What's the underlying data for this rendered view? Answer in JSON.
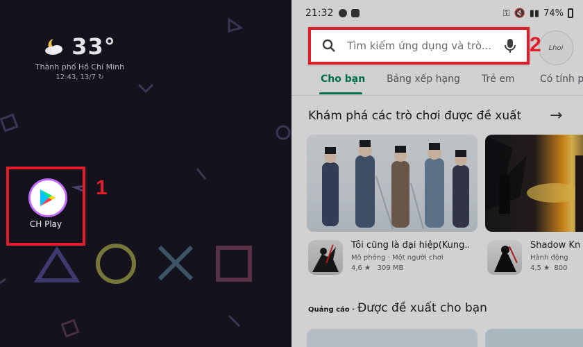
{
  "home": {
    "weather": {
      "temperature": "33°",
      "city": "Thành phố Hồ Chí Minh",
      "datetime": "12:43, 13/7"
    },
    "app": {
      "label": "CH Play"
    },
    "step": "1"
  },
  "store": {
    "status": {
      "time": "21:32",
      "battery": "74%"
    },
    "search": {
      "placeholder": "Tìm kiếm ứng dụng và trò..."
    },
    "avatar_text": "Lhoi",
    "step": "2",
    "tabs": [
      "Cho bạn",
      "Bảng xếp hạng",
      "Trẻ em",
      "Có tính p"
    ],
    "section_title": "Khám phá các trò chơi được đề xuất",
    "games": [
      {
        "name": "Tôi cũng là đại hiệp(Kung...",
        "meta": "Mô phỏng · Một người chơi",
        "rating": "4,6 ★",
        "size": "309 MB"
      },
      {
        "name": "Shadow Kn",
        "meta": "Hành động",
        "rating": "4,5 ★",
        "size": "800"
      }
    ],
    "ad_tag": "Quảng cáo ·",
    "ad_section_title": "Được đề xuất cho bạn"
  },
  "colors": {
    "highlight": "#e11d2a",
    "accent_green": "#01875f",
    "home_bg": "#14121c"
  }
}
